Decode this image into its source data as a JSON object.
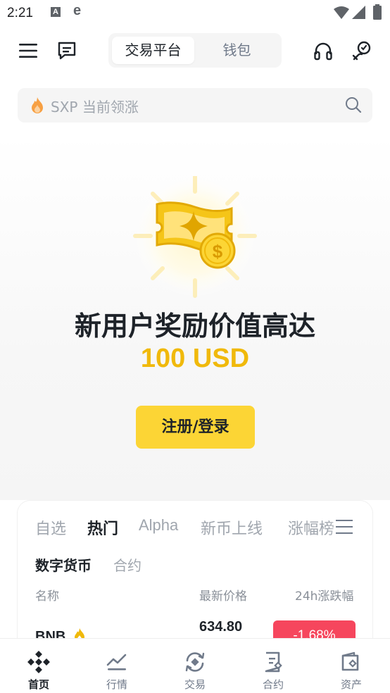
{
  "status_bar": {
    "time": "2:21",
    "icon_a": "A",
    "icon_e": "e"
  },
  "header": {
    "tabs": [
      {
        "label": "交易平台",
        "active": true
      },
      {
        "label": "钱包",
        "active": false
      }
    ]
  },
  "search": {
    "placeholder": "SXP 当前领涨"
  },
  "hero": {
    "title": "新用户奖励价值高达",
    "amount": "100 USD",
    "cta_label": "注册/登录"
  },
  "market": {
    "tabs": [
      "自选",
      "热门",
      "Alpha",
      "新币上线",
      "涨幅榜"
    ],
    "active_tab": "热门",
    "subtabs": [
      "数字货币",
      "合约"
    ],
    "active_subtab": "数字货币",
    "columns": {
      "name": "名称",
      "price": "最新价格",
      "change": "24h涨跌幅"
    },
    "rows": [
      {
        "symbol": "BNB",
        "price": "634.80",
        "change": "-1.68%"
      }
    ]
  },
  "bottom_nav": {
    "items": [
      {
        "label": "首页",
        "icon": "binance-logo-icon",
        "active": true
      },
      {
        "label": "行情",
        "icon": "chart-trend-icon",
        "active": false
      },
      {
        "label": "交易",
        "icon": "trade-swap-icon",
        "active": false
      },
      {
        "label": "合约",
        "icon": "contract-doc-icon",
        "active": false
      },
      {
        "label": "资产",
        "icon": "wallet-icon",
        "active": false
      }
    ]
  },
  "colors": {
    "brand_yellow": "#fcd535",
    "accent_gold": "#f0b90b",
    "down_red": "#f6465d",
    "text_primary": "#1e2329",
    "text_muted": "#a0a6ae"
  }
}
